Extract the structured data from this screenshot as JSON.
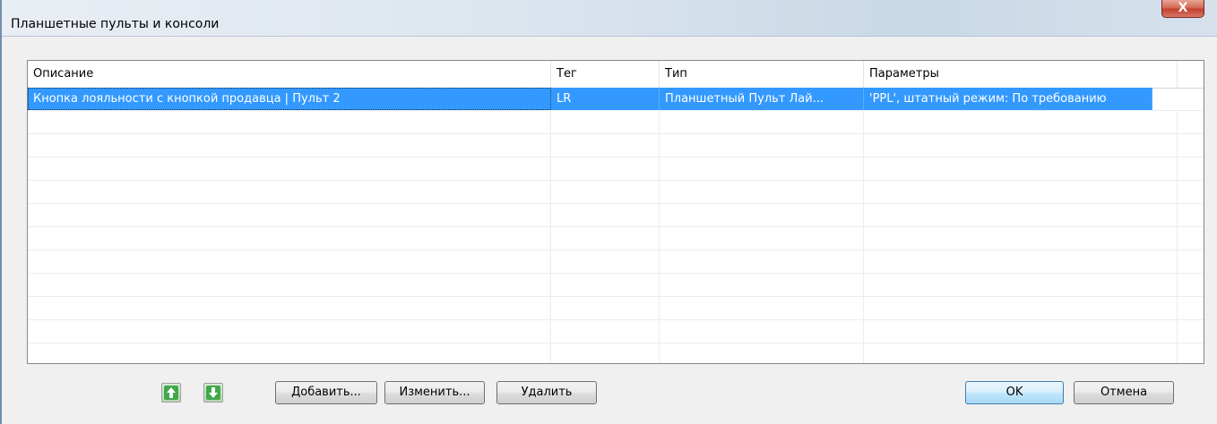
{
  "window": {
    "title": "Планшетные пульты и консоли",
    "close_label": "X"
  },
  "table": {
    "columns": [
      "Описание",
      "Тег",
      "Тип",
      "Параметры"
    ],
    "rows": [
      {
        "description": "Кнопка лояльности с кнопкой продавца | Пульт 2",
        "tag": "LR",
        "type": "Планшетный Пульт Лай...",
        "params": "'PPL', штатный режим: По требованию",
        "selected": true
      }
    ]
  },
  "buttons": {
    "move_up_icon": "arrow-up-icon",
    "move_down_icon": "arrow-down-icon",
    "add": "Добавить...",
    "edit": "Изменить...",
    "delete": "Удалить",
    "ok": "OK",
    "cancel": "Отмена"
  },
  "colors": {
    "selection": "#3399ff",
    "arrow_green": "#4caf50"
  }
}
